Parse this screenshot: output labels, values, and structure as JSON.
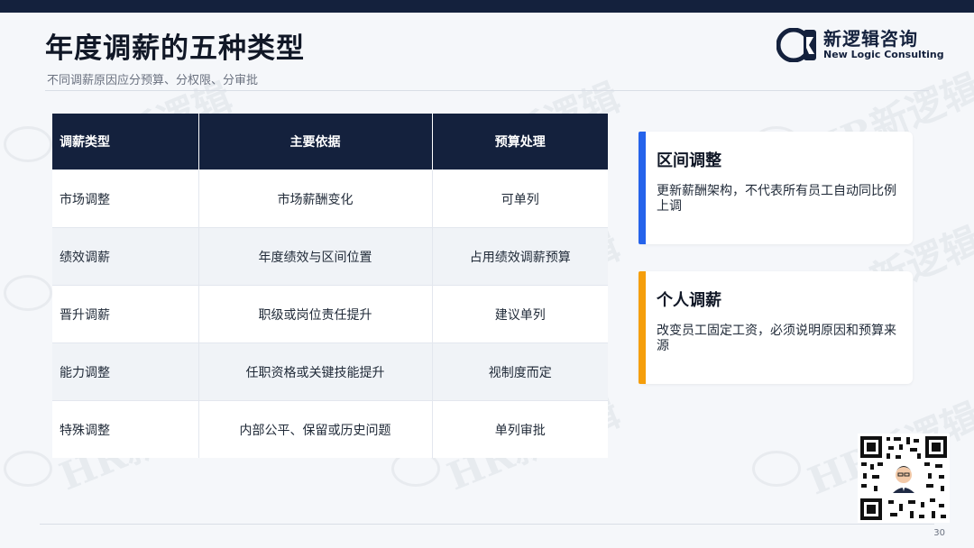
{
  "header": {
    "title": "年度调薪的五种类型",
    "subtitle": "不同调薪原因应分预算、分权限、分审批"
  },
  "logo": {
    "cn": "新逻辑咨询",
    "en": "New Logic Consulting"
  },
  "watermark_text": "HR新逻辑",
  "table": {
    "columns": [
      "调薪类型",
      "主要依据",
      "预算处理"
    ],
    "rows": [
      [
        "市场调整",
        "市场薪酬变化",
        "可单列"
      ],
      [
        "绩效调薪",
        "年度绩效与区间位置",
        "占用绩效调薪预算"
      ],
      [
        "晋升调薪",
        "职级或岗位责任提升",
        "建议单列"
      ],
      [
        "能力调整",
        "任职资格或关键技能提升",
        "视制度而定"
      ],
      [
        "特殊调整",
        "内部公平、保留或历史问题",
        "单列审批"
      ]
    ]
  },
  "cards": [
    {
      "title": "区间调整",
      "desc": "更新薪酬架构，不代表所有员工自动同比例上调",
      "accent": "#2563eb"
    },
    {
      "title": "个人调薪",
      "desc": "改变员工固定工资，必须说明原因和预算来源",
      "accent": "#f59e0b"
    }
  ],
  "footer": {
    "page_number": "30"
  },
  "colors": {
    "navy": "#14213d",
    "blue_accent": "#2563eb",
    "amber_accent": "#f59e0b"
  }
}
